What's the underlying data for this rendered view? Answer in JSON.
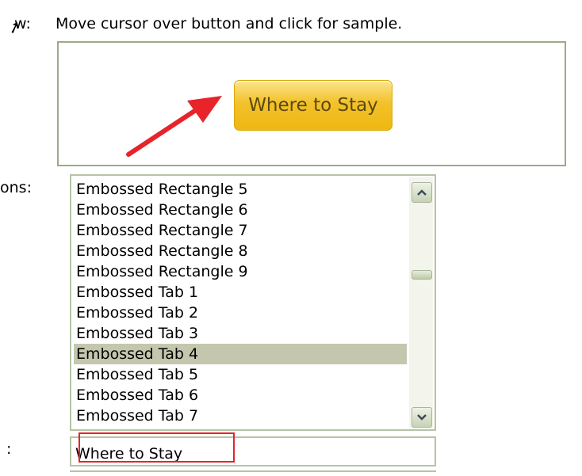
{
  "labels": {
    "preview": "w:",
    "buttons": "ons:",
    "text": ":"
  },
  "instructions": "Move cursor over button and click for sample.",
  "preview": {
    "sample_button_label": "Where to Stay"
  },
  "button_list": {
    "items": [
      "Embossed Rectangle 5",
      "Embossed Rectangle 6",
      "Embossed Rectangle 7",
      "Embossed Rectangle 8",
      "Embossed Rectangle 9",
      "Embossed Tab 1",
      "Embossed Tab 2",
      "Embossed Tab 3",
      "Embossed Tab 4",
      "Embossed Tab 5",
      "Embossed Tab 6",
      "Embossed Tab 7"
    ],
    "selected": "Embossed Tab 4"
  },
  "text_field": {
    "value": "Where to Stay"
  },
  "colors": {
    "button_yellow": "#f3c12a",
    "selection": "#c4c7ad",
    "highlight_red": "#e5242a",
    "border_green": "#b5c4a6"
  },
  "icons": {
    "cursor": "mouse-cursor-icon",
    "scroll_up": "chevron-up-icon",
    "scroll_down": "chevron-down-icon",
    "annotation": "red-arrow-icon"
  }
}
